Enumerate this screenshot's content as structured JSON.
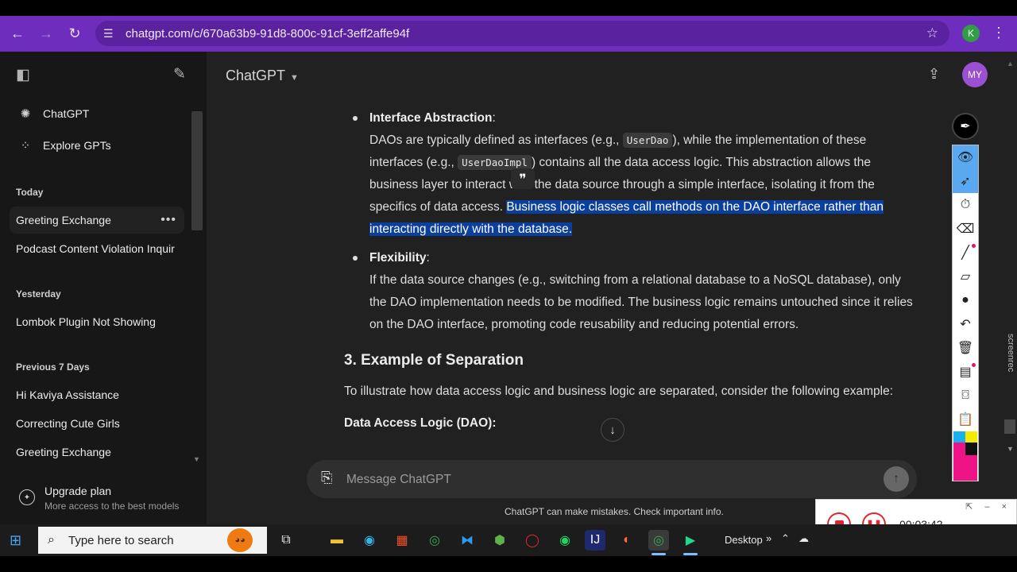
{
  "browser": {
    "url": "chatgpt.com/c/670a63b9-91d8-800c-91cf-3eff2affe94f",
    "profile_initial": "K"
  },
  "sidebar": {
    "top_items": [
      {
        "label": "ChatGPT",
        "icon": "openai-logo-icon"
      },
      {
        "label": "Explore GPTs",
        "icon": "grid-icon"
      }
    ],
    "sections": [
      {
        "heading": "Today",
        "items": [
          "Greeting Exchange",
          "Podcast Content Violation Inquir"
        ]
      },
      {
        "heading": "Yesterday",
        "items": [
          "Lombok Plugin Not Showing"
        ]
      },
      {
        "heading": "Previous 7 Days",
        "items": [
          "Hi Kaviya Assistance",
          "Correcting Cute Girls",
          "Greeting Exchange"
        ]
      }
    ],
    "upgrade": {
      "title": "Upgrade plan",
      "subtitle": "More access to the best models"
    }
  },
  "header": {
    "title": "ChatGPT",
    "avatar_initials": "MY"
  },
  "content": {
    "bullet1": {
      "title": "Interface Abstraction",
      "text_a": "DAOs are typically defined as interfaces (e.g., ",
      "code_a": "UserDao",
      "text_b": "), while the implementation of these interfaces (e.g., ",
      "code_b": "UserDaoImpl",
      "text_c": ") contains all the data access logic. This abstraction allows the business layer to interact with the data source through a simple interface, isolating it from the specifics of data access. ",
      "highlight": "Business logic classes call methods on the DAO interface rather than interacting directly with the database."
    },
    "bullet2": {
      "title": "Flexibility",
      "text": "If the data source changes (e.g., switching from a relational database to a NoSQL database), only the DAO implementation needs to be modified. The business logic remains untouched since it relies on the DAO interface, promoting code reusability and reducing potential errors."
    },
    "section_heading": "3. Example of Separation",
    "section_intro": "To illustrate how data access logic and business logic are separated, consider the following example:",
    "subheading": "Data Access Logic (DAO):"
  },
  "composer": {
    "placeholder": "Message ChatGPT",
    "disclaimer": "ChatGPT can make mistakes. Check important info."
  },
  "recorder": {
    "time": "00:03:42",
    "brand": "screenrec"
  },
  "taskbar": {
    "search_placeholder": "Type here to search",
    "desktop_label": "Desktop",
    "apps": [
      "task-view-icon",
      "file-explorer-icon",
      "edge-icon",
      "store-icon",
      "chrome-icon",
      "vscode-icon",
      "node-icon",
      "opera-icon",
      "spotify-icon",
      "intellij-icon",
      "postman-icon",
      "chrome-profile-icon",
      "pycharm-icon"
    ]
  },
  "colors": {
    "browser_accent": "#6f2dbd",
    "highlight": "#0b3f9e",
    "record_red": "#e0262c"
  }
}
